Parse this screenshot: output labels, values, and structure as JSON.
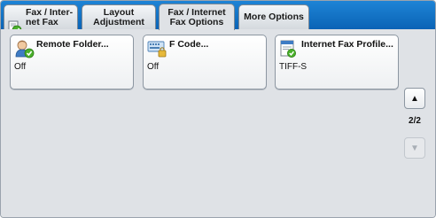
{
  "tabs": [
    {
      "label": "Fax / Inter-\nnet Fax",
      "icon": "fax-icon",
      "active": false
    },
    {
      "label": "Layout\nAdjustment",
      "active": false
    },
    {
      "label": "Fax / Internet\nFax Options",
      "active": true
    },
    {
      "label": "More Options",
      "active": false
    }
  ],
  "features": [
    {
      "title": "Remote Folder...",
      "value": "Off",
      "icon": "remote-folder-icon"
    },
    {
      "title": "F Code...",
      "value": "Off",
      "icon": "f-code-icon"
    },
    {
      "title": "Internet Fax Profile...",
      "value": "TIFF-S",
      "icon": "internet-fax-profile-icon"
    }
  ],
  "pager": {
    "indicator": "2/2",
    "up_glyph": "▲",
    "down_glyph": "▼"
  },
  "colors": {
    "tab_bar": "#0a63b6",
    "panel_bg": "#dfe2e6",
    "check_green": "#49b02a"
  }
}
